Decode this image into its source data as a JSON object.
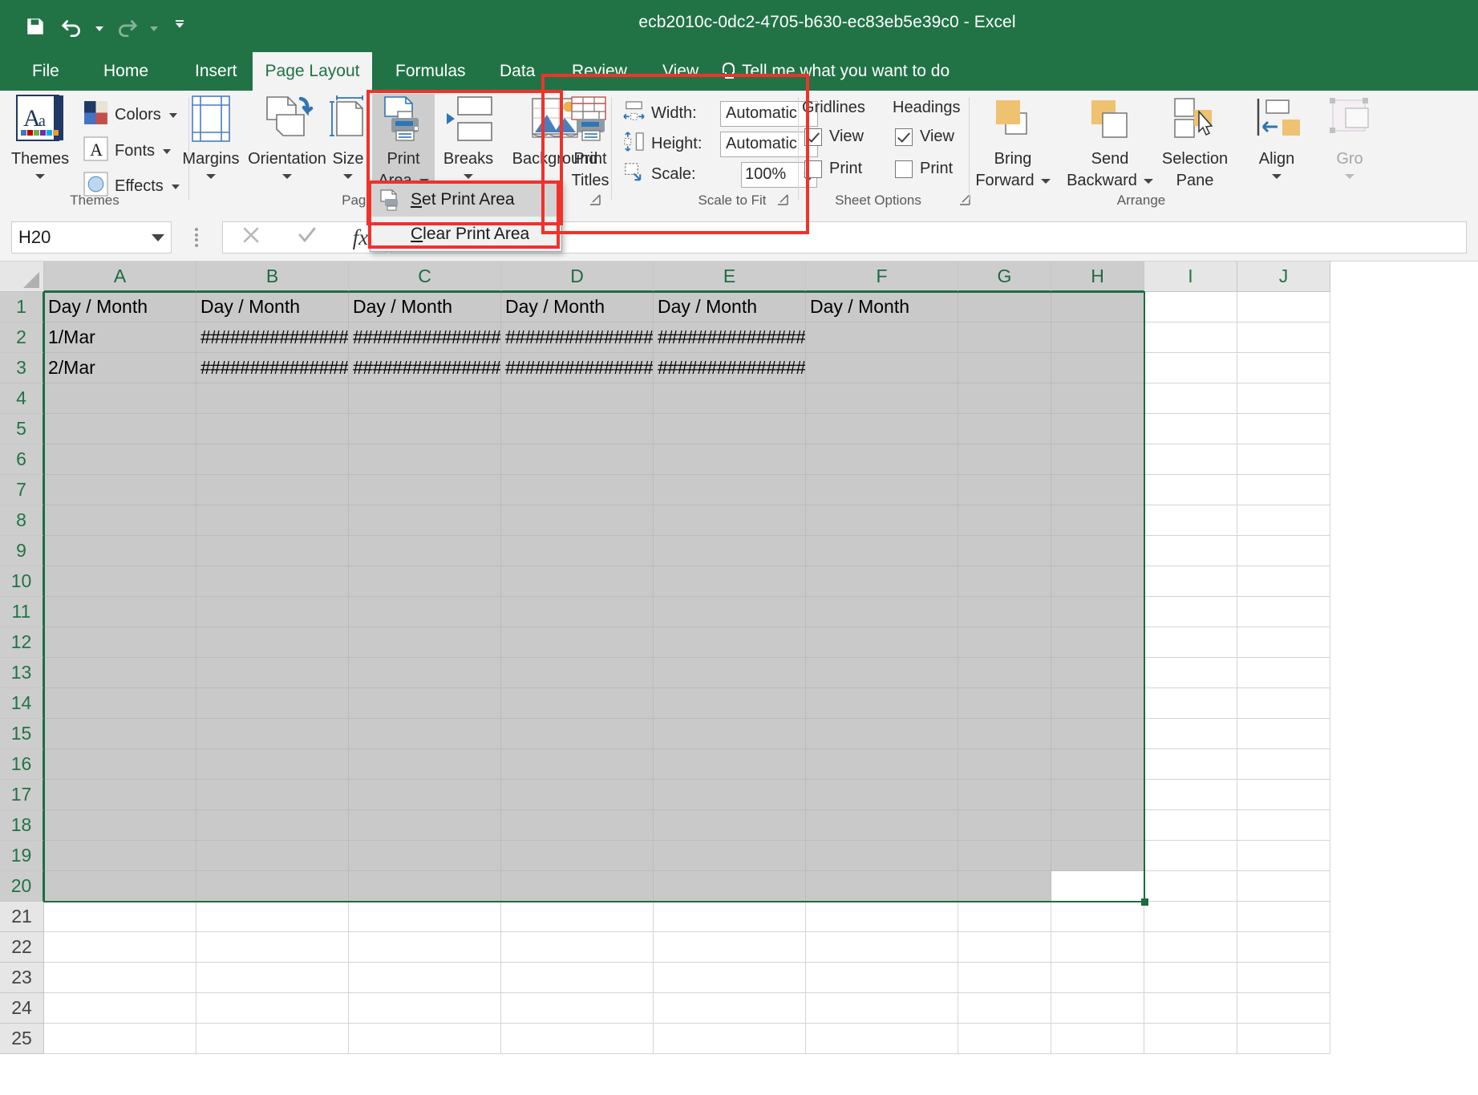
{
  "window": {
    "title": "ecb2010c-0dc2-4705-b630-ec83eb5e39c0  -  Excel",
    "accent_color": "#217346",
    "annotation_color": "#f0322b"
  },
  "quick_access": {
    "save": "save-icon",
    "undo": "undo-icon",
    "redo": "redo-icon",
    "customize": "customize-qat-icon"
  },
  "tabs": [
    {
      "label": "File",
      "active": false
    },
    {
      "label": "Home",
      "active": false
    },
    {
      "label": "Insert",
      "active": false
    },
    {
      "label": "Page Layout",
      "active": true
    },
    {
      "label": "Formulas",
      "active": false
    },
    {
      "label": "Data",
      "active": false
    },
    {
      "label": "Review",
      "active": false
    },
    {
      "label": "View",
      "active": false
    }
  ],
  "tell_me": {
    "label": "Tell me what you want to do",
    "icon": "lightbulb-icon"
  },
  "ribbon": {
    "groups": [
      {
        "name": "Themes",
        "label": "Themes"
      },
      {
        "name": "Page Setup",
        "label": "Page"
      },
      {
        "name": "Scale to Fit",
        "label": "Scale to Fit"
      },
      {
        "name": "Sheet Options",
        "label": "Sheet Options"
      },
      {
        "name": "Arrange",
        "label": "Arrange"
      }
    ],
    "themes": {
      "themes_label": "Themes",
      "colors_label": "Colors",
      "fonts_label": "Fonts",
      "effects_label": "Effects"
    },
    "page_setup": {
      "margins_label": "Margins",
      "orientation_label": "Orientation",
      "size_label": "Size",
      "print_area_label_1": "Print",
      "print_area_label_2": "Area",
      "breaks_label": "Breaks",
      "background_label": "Background",
      "print_titles_label_1": "Print",
      "print_titles_label_2": "Titles"
    },
    "scale_to_fit": {
      "width_label": "Width:",
      "width_value": "Automatic",
      "height_label": "Height:",
      "height_value": "Automatic",
      "scale_label": "Scale:",
      "scale_value": "100%"
    },
    "sheet_options": {
      "gridlines_label": "Gridlines",
      "headings_label": "Headings",
      "gridlines_view_label": "View",
      "gridlines_view_checked": true,
      "gridlines_print_label": "Print",
      "gridlines_print_checked": false,
      "headings_view_label": "View",
      "headings_view_checked": true,
      "headings_print_label": "Print",
      "headings_print_checked": false
    },
    "arrange": {
      "bring_forward_1": "Bring",
      "bring_forward_2": "Forward",
      "send_backward_1": "Send",
      "send_backward_2": "Backward",
      "selection_pane_1": "Selection",
      "selection_pane_2": "Pane",
      "align_label": "Align",
      "group_label": "Gro"
    }
  },
  "print_area_menu": {
    "items": [
      {
        "label": "Set Print Area",
        "accel": "S",
        "icon": "set-print-area-icon",
        "highlighted": true
      },
      {
        "label": "Clear Print Area",
        "accel": "C",
        "icon": "",
        "highlighted": false
      }
    ]
  },
  "formula_bar": {
    "name_box_value": "H20",
    "cancel_icon": "cancel-icon",
    "enter_icon": "enter-icon",
    "function_icon": "fx-icon",
    "input_value": ""
  },
  "sheet": {
    "columns": [
      "A",
      "B",
      "C",
      "D",
      "E",
      "F",
      "G",
      "H",
      "I",
      "J"
    ],
    "rows": [
      1,
      2,
      3,
      4,
      5,
      6,
      7,
      8,
      9,
      10,
      11,
      12,
      13,
      14,
      15,
      16,
      17,
      18,
      19,
      20,
      21,
      22,
      23,
      24,
      25
    ],
    "selection_range": "A1:H20",
    "active_cell": "H20",
    "data": [
      [
        "Day / Month",
        "Day / Month",
        "Day / Month",
        "Day / Month",
        "Day / Month",
        "Day / Month",
        "",
        ""
      ],
      [
        "1/Mar",
        "################",
        "################",
        "################",
        "################",
        "",
        "",
        ""
      ],
      [
        "2/Mar",
        "################",
        "################",
        "################",
        "################",
        "",
        "",
        ""
      ]
    ]
  }
}
